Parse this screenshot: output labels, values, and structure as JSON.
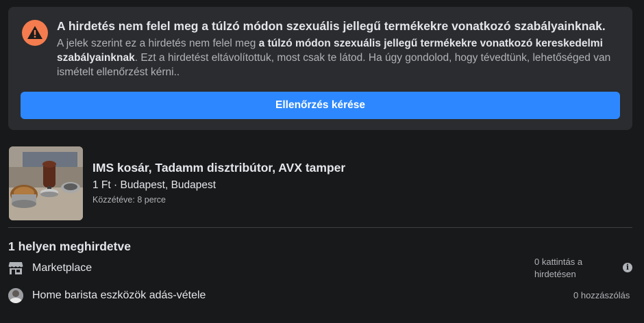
{
  "alert": {
    "title": "A hirdetés nem felel meg a túlzó módon szexuális jellegű termékekre vonatkozó szabályainknak.",
    "body_prefix": "A jelek szerint ez a hirdetés nem felel meg ",
    "body_bold": "a túlzó módon szexuális jellegű termékekre vonatkozó kereskedelmi szabályainknak",
    "body_suffix": ". Ezt a hirdetést eltávolítottuk, most csak te látod. Ha úgy gondolod, hogy tévedtünk, lehetőséged van ismételt ellenőrzést kérni..",
    "button_label": "Ellenőrzés kérése",
    "icon": "warning-icon",
    "icon_color": "#f47c4e",
    "button_color": "#2d88ff"
  },
  "listing": {
    "title": "IMS kosár, Tadamm disztribútor, AVX tamper",
    "meta": "1 Ft · Budapest, Budapest",
    "posted": "Közzétéve: 8 perce"
  },
  "placements": {
    "title": "1 helyen meghirdetve",
    "items": [
      {
        "icon": "marketplace-icon",
        "label": "Marketplace",
        "stat": "0 kattintás a hirdetésen"
      },
      {
        "icon": "group-avatar",
        "label": "Home barista eszközök adás-vétele",
        "stat": "0 hozzászólás"
      }
    ]
  }
}
